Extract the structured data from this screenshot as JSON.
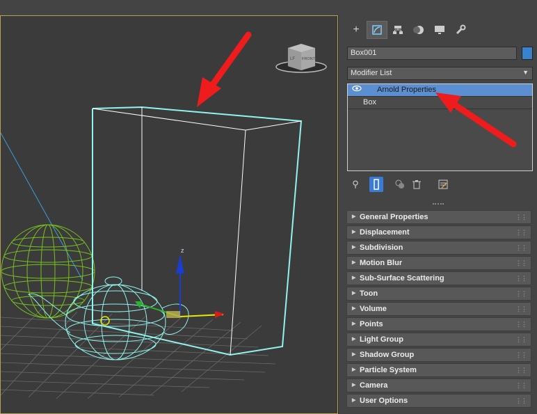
{
  "object_name": "Box001",
  "modifier_list": {
    "label": "Modifier List"
  },
  "stack": [
    {
      "label": "Arnold Properties",
      "selected": true,
      "visible_icon": "eye-icon"
    },
    {
      "label": "Box",
      "selected": false
    }
  ],
  "command_tabs": [
    "create-icon",
    "modify-icon",
    "hierarchy-icon",
    "motion-icon",
    "display-icon",
    "utilities-icon"
  ],
  "stack_tools": [
    "pin-stack-icon",
    "show-end-result-icon",
    "make-unique-icon",
    "remove-modifier-icon",
    "configure-modifier-sets-icon"
  ],
  "viewcube": {
    "face_left": "LF",
    "face_right": "FRONT"
  },
  "gizmo": {
    "axis_label": "z"
  },
  "rollouts": [
    "General Properties",
    "Displacement",
    "Subdivision",
    "Motion Blur",
    "Sub-Surface Scattering",
    "Toon",
    "Volume",
    "Points",
    "Light Group",
    "Shadow Group",
    "Particle System",
    "Camera",
    "User Options"
  ],
  "colors": {
    "wire_selected": "#8ff5ee",
    "wire_sphere": "#78c11d",
    "accent_blue": "#5b8fd1",
    "annotation_red": "#ee1c1c",
    "object_color": "#3b82cc"
  }
}
